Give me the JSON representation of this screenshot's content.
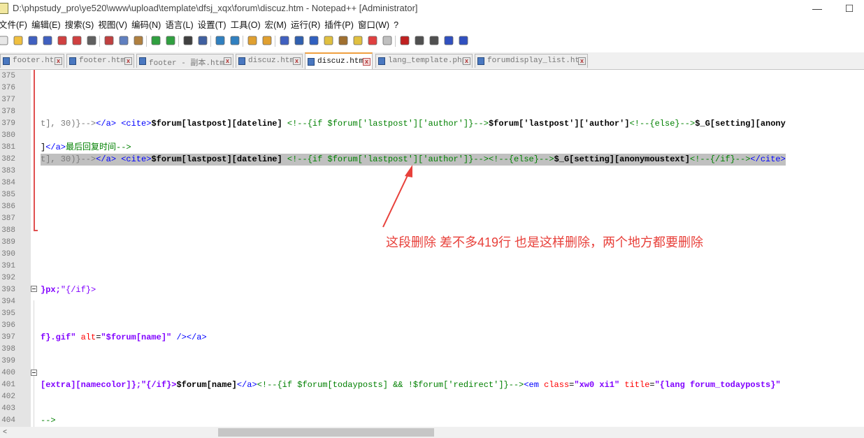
{
  "window": {
    "title": "D:\\phpstudy_pro\\ye520\\www\\upload\\template\\dfsj_xqx\\forum\\discuz.htm - Notepad++ [Administrator]",
    "minimize_glyph": "—",
    "maximize_glyph": "☐"
  },
  "menu": [
    "文件(F)",
    "编辑(E)",
    "搜索(S)",
    "视图(V)",
    "编码(N)",
    "语言(L)",
    "设置(T)",
    "工具(O)",
    "宏(M)",
    "运行(R)",
    "插件(P)",
    "窗口(W)",
    "?"
  ],
  "toolbar_icons": [
    "new-file-icon",
    "open-file-icon",
    "save-icon",
    "save-all-icon",
    "close-icon",
    "close-all-icon",
    "print-icon",
    "cut-icon",
    "copy-icon",
    "paste-icon",
    "undo-icon",
    "redo-icon",
    "find-icon",
    "replace-icon",
    "zoom-in-icon",
    "zoom-out-icon",
    "sync-vertical-icon",
    "sync-horizontal-icon",
    "word-wrap-icon",
    "show-all-chars-icon",
    "indent-guide-icon",
    "lang-icon",
    "doc-map-icon",
    "function-list-icon",
    "folder-workspace-icon",
    "monitor-icon",
    "record-macro-icon",
    "stop-macro-icon",
    "play-macro-icon",
    "run-macro-multiple-icon",
    "save-macro-icon"
  ],
  "tabs": [
    {
      "label": "footer.htm",
      "active": false
    },
    {
      "label": "footer.htm",
      "active": false
    },
    {
      "label": "footer - 副本.htm",
      "active": false
    },
    {
      "label": "discuz.htm",
      "active": false
    },
    {
      "label": "discuz.htm",
      "active": true
    },
    {
      "label": "lang_template.php",
      "active": false
    },
    {
      "label": "forumdisplay_list.htm",
      "active": false
    }
  ],
  "tab_close_glyph": "x",
  "lines": [
    {
      "n": "375",
      "code": []
    },
    {
      "n": "376",
      "code": []
    },
    {
      "n": "377",
      "code": []
    },
    {
      "n": "378",
      "code": []
    },
    {
      "n": "379",
      "code": [
        {
          "t": "t], 30)}-->",
          "c": "#7a7a7a"
        },
        {
          "t": "</a> ",
          "c": "#0000ff"
        },
        {
          "t": "<cite>",
          "c": "#0000ff"
        },
        {
          "t": "$forum[lastpost][dateline] ",
          "c": "#000000",
          "b": true
        },
        {
          "t": "<!--{if $forum['lastpost']['author']}-->",
          "c": "#008000"
        },
        {
          "t": "$forum['lastpost']['author']",
          "c": "#000000",
          "b": true
        },
        {
          "t": "<!--{else}-->",
          "c": "#008000"
        },
        {
          "t": "$_G[setting][anony",
          "c": "#000000",
          "b": true
        }
      ]
    },
    {
      "n": "380",
      "code": []
    },
    {
      "n": "381",
      "code": [
        {
          "t": "]",
          "c": "#000000"
        },
        {
          "t": "</a>",
          "c": "#0000ff"
        },
        {
          "t": "最后回复时间-->",
          "c": "#008000"
        }
      ]
    },
    {
      "n": "382",
      "sel": true,
      "code": [
        {
          "t": "t], 30)}-->",
          "c": "#7a7a7a"
        },
        {
          "t": "</a> ",
          "c": "#0000ff"
        },
        {
          "t": "<cite>",
          "c": "#0000ff"
        },
        {
          "t": "$forum[lastpost][dateline] ",
          "c": "#000000",
          "b": true
        },
        {
          "t": "<!--{if $forum['lastpost']['author']}-->",
          "c": "#008000"
        },
        {
          "t": "<!--{else}-->",
          "c": "#008000"
        },
        {
          "t": "$_G[setting][anonymoustext]",
          "c": "#000000",
          "b": true
        },
        {
          "t": "<!--{/if}-->",
          "c": "#008000"
        },
        {
          "t": "</cite>",
          "c": "#0000ff"
        }
      ]
    },
    {
      "n": "383",
      "code": []
    },
    {
      "n": "384",
      "code": []
    },
    {
      "n": "385",
      "code": []
    },
    {
      "n": "386",
      "code": []
    },
    {
      "n": "387",
      "code": []
    },
    {
      "n": "388",
      "code": []
    },
    {
      "n": "389",
      "code": []
    },
    {
      "n": "390",
      "code": []
    },
    {
      "n": "391",
      "code": []
    },
    {
      "n": "392",
      "code": []
    },
    {
      "n": "393",
      "code": [
        {
          "t": "}px;",
          "c": "#8000ff",
          "b": true
        },
        {
          "t": "\"{/if}>",
          "c": "#8000ff"
        }
      ]
    },
    {
      "n": "394",
      "code": []
    },
    {
      "n": "395",
      "code": []
    },
    {
      "n": "396",
      "code": []
    },
    {
      "n": "397",
      "code": [
        {
          "t": "f}.gif\" ",
          "c": "#8000ff",
          "b": true
        },
        {
          "t": "alt",
          "c": "#ff0000"
        },
        {
          "t": "=",
          "c": "#000000"
        },
        {
          "t": "\"$forum[name]\" ",
          "c": "#8000ff",
          "b": true
        },
        {
          "t": "/>",
          "c": "#0000ff"
        },
        {
          "t": "</a>",
          "c": "#0000ff"
        }
      ]
    },
    {
      "n": "398",
      "code": []
    },
    {
      "n": "399",
      "code": []
    },
    {
      "n": "400",
      "code": []
    },
    {
      "n": "401",
      "code": [
        {
          "t": "[extra][namecolor]};\"{/if}>",
          "c": "#8000ff",
          "b": true
        },
        {
          "t": "$forum[name]",
          "c": "#000000",
          "b": true
        },
        {
          "t": "</a>",
          "c": "#0000ff"
        },
        {
          "t": "<!--{if $forum[todayposts] && !$forum['redirect']}-->",
          "c": "#008000"
        },
        {
          "t": "<em ",
          "c": "#0000ff"
        },
        {
          "t": "class",
          "c": "#ff0000"
        },
        {
          "t": "=",
          "c": "#000000"
        },
        {
          "t": "\"xw0 xi1\" ",
          "c": "#8000ff",
          "b": true
        },
        {
          "t": "title",
          "c": "#ff0000"
        },
        {
          "t": "=",
          "c": "#000000"
        },
        {
          "t": "\"{lang forum_todayposts}\"",
          "c": "#8000ff",
          "b": true
        }
      ]
    },
    {
      "n": "402",
      "code": []
    },
    {
      "n": "403",
      "code": []
    },
    {
      "n": "404",
      "code": [
        {
          "t": "-->",
          "c": "#008000"
        }
      ]
    }
  ],
  "annotation": {
    "text": "这段删除  差不多419行 也是这样删除，两个地方都要删除",
    "color": "#e8413b"
  },
  "scroll_left_glyph": "<"
}
